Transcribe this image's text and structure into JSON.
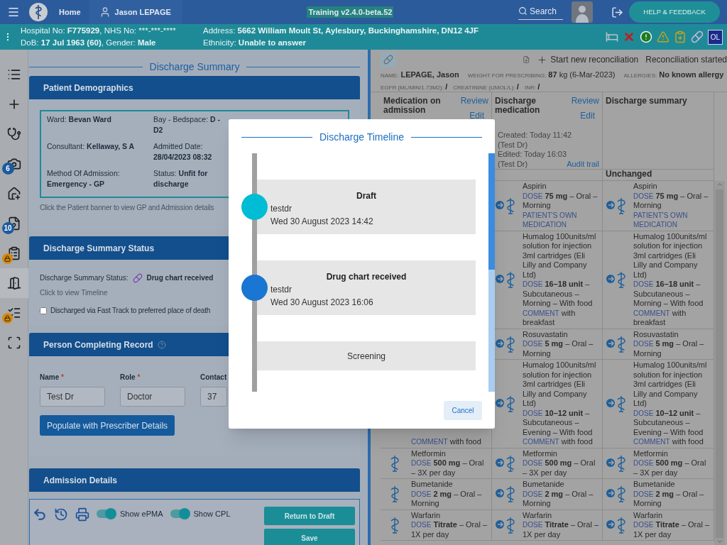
{
  "top_bar": {
    "home": "Home",
    "patient": "Jason LEPAGE",
    "version": "Training v2.4.0-beta.52",
    "search": "Search",
    "help": "HELP & FEEDBACK"
  },
  "banner": {
    "columns": [
      [
        [
          "Hospital No: ",
          "F775929",
          ", NHS No: ***-***-****"
        ],
        [
          "DoB: ",
          "17 Jul 1963 (60)",
          ", Gender: ",
          "Male"
        ]
      ],
      [
        [
          "Address: ",
          "5662 William Moult St, Aylesbury, Buckinghamshire, DN12 4JF"
        ],
        [
          "Ethnicity: ",
          "Unable to answer"
        ]
      ]
    ],
    "badge": "OL"
  },
  "rail": [
    {
      "kind": "list",
      "selected": false
    },
    {
      "kind": "add",
      "selected": false
    },
    {
      "kind": "stethoscope",
      "selected": false
    },
    {
      "kind": "camera",
      "selected": false,
      "badge": "6"
    },
    {
      "kind": "home",
      "selected": false
    },
    {
      "kind": "document",
      "selected": false,
      "badge": "10"
    },
    {
      "kind": "clipboard",
      "selected": false,
      "locked": true
    },
    {
      "kind": "discharge",
      "selected": true
    },
    {
      "kind": "checklist",
      "selected": false,
      "locked": true
    },
    {
      "kind": "xray",
      "selected": false
    }
  ],
  "form": {
    "title": "Discharge Summary",
    "demographics": {
      "header": "Patient Demographics",
      "fields": [
        {
          "label": "Ward:",
          "value": "Bevan Ward"
        },
        {
          "label": "Bay - Bedspace:",
          "value": "D - D2"
        },
        {
          "label": "Consultant:",
          "value": "Kellaway, S A"
        },
        {
          "label": "Admitted Date:",
          "value": "28/04/2023 08:32"
        },
        {
          "label": "Method Of Admission:",
          "value": "Emergency - GP"
        },
        {
          "label": "Status:",
          "value": "Unfit for discharge"
        }
      ],
      "hint": "Click the Patient banner to view GP and Admission details"
    },
    "status": {
      "header": "Discharge Summary Status",
      "label": "Discharge Summary Status:",
      "value": "Drug chart received",
      "link": "Click to view Timeline",
      "checkbox": {
        "label": "Discharged via Fast Track to preferred place of death",
        "checked": false
      }
    },
    "person": {
      "header": "Person Completing Record",
      "fields": [
        {
          "label": "Name",
          "required": "*",
          "value": "Test Dr"
        },
        {
          "label": "Role",
          "required": "*",
          "value": "Doctor"
        },
        {
          "label": "Contact",
          "value": "37"
        }
      ],
      "button": "Populate with Prescriber Details"
    },
    "admission": {
      "header": "Admission Details"
    },
    "toolbar": {
      "toggles": [
        {
          "label": "Show ePMA",
          "on": true
        },
        {
          "label": "Show CPL",
          "on": true
        }
      ],
      "buttons": [
        "Return to Draft",
        "Save"
      ]
    }
  },
  "meds": {
    "toolbar": {
      "start": "Start new reconciliation",
      "started": "Reconciliation started"
    },
    "patient": [
      {
        "label": "NAME:",
        "value": "LEPAGE, Jason"
      },
      {
        "label": "WEIGHT FOR PRESCRIBING:",
        "value": "87",
        "extra": "kg (6-Mar-2023)"
      },
      {
        "label": "ALLERGIES:",
        "value": "No known allergy"
      }
    ],
    "labs": [
      {
        "label": "EGFR (ML/MIN/1.73M2):",
        "value": "/"
      },
      {
        "label": "CREATININE (UMOL/L):",
        "value": "/"
      },
      {
        "label": "INR:",
        "value": "/"
      }
    ],
    "columns": [
      {
        "title": "Medication on admission",
        "links": [
          "Review",
          "Edit"
        ]
      },
      {
        "title": "Discharge medication",
        "links": [
          "Review",
          "Edit"
        ],
        "info": [
          "Created: Today 11:42",
          "(Test Dr)",
          "Edited: Today 16:03",
          "(Test Dr)"
        ],
        "audit": "Audit trail"
      },
      {
        "title": "Discharge summary"
      }
    ],
    "group": "Unchanged",
    "rows": [
      {
        "discharge": {
          "kind": "transfer",
          "name": "Aspirin",
          "dose_label": "DOSE",
          "dose": "75 mg",
          "rest": "– Oral – Morning",
          "note_label": "PATIENT'S OWN MEDICATION"
        },
        "summary": {
          "kind": "transfer",
          "name": "Aspirin",
          "dose_label": "DOSE",
          "dose": "75 mg",
          "rest": "– Oral – Morning",
          "note_label": "PATIENT'S OWN MEDICATION"
        }
      },
      {
        "discharge": {
          "kind": "transfer",
          "name": "Humalog 100units/ml solution for injection 3ml cartridges (Eli Lilly and Company Ltd)",
          "dose_label": "DOSE",
          "dose": "16–18 unit",
          "rest": "– Subcutaneous – Morning – With food",
          "note_label": "COMMENT",
          "note": "with breakfast"
        },
        "summary": {
          "kind": "transfer",
          "name": "Humalog 100units/ml solution for injection 3ml cartridges (Eli Lilly and Company Ltd)",
          "dose_label": "DOSE",
          "dose": "16–18 unit",
          "rest": "– Subcutaneous – Morning – With food",
          "note_label": "COMMENT",
          "note": "with breakfast"
        }
      },
      {
        "discharge": {
          "kind": "transfer",
          "name": "Rosuvastatin",
          "dose_label": "DOSE",
          "dose": "5 mg",
          "rest": "– Oral – Morning"
        },
        "summary": {
          "kind": "transfer",
          "name": "Rosuvastatin",
          "dose_label": "DOSE",
          "dose": "5 mg",
          "rest": "– Oral – Morning"
        }
      },
      {
        "admission": {
          "note_label": "COMMENT",
          "note": "with food"
        },
        "discharge": {
          "kind": "transfer",
          "name": "Humalog 100units/ml solution for injection 3ml cartridges (Eli Lilly and Company Ltd)",
          "dose_label": "DOSE",
          "dose": "10–12 unit",
          "rest": "– Subcutaneous – Evening – With food",
          "note_label": "COMMENT",
          "note": "with food"
        },
        "summary": {
          "kind": "transfer",
          "name": "Humalog 100units/ml solution for injection 3ml cartridges (Eli Lilly and Company Ltd)",
          "dose_label": "DOSE",
          "dose": "10–12 unit",
          "rest": "– Subcutaneous – Evening – With food",
          "note_label": "COMMENT",
          "note": "with food"
        }
      },
      {
        "admission": {
          "kind": "plain",
          "name": "Metformin",
          "dose_label": "DOSE",
          "dose": "500 mg",
          "rest": "– Oral – 3X per day"
        },
        "discharge": {
          "kind": "transfer",
          "name": "Metformin",
          "dose_label": "DOSE",
          "dose": "500 mg",
          "rest": "– Oral – 3X per day"
        },
        "summary": {
          "kind": "transfer",
          "name": "Metformin",
          "dose_label": "DOSE",
          "dose": "500 mg",
          "rest": "– Oral – 3X per day"
        }
      },
      {
        "admission": {
          "kind": "plain",
          "name": "Bumetanide",
          "dose_label": "DOSE",
          "dose": "2 mg",
          "rest": "– Oral – Morning"
        },
        "discharge": {
          "kind": "transfer",
          "name": "Bumetanide",
          "dose_label": "DOSE",
          "dose": "2 mg",
          "rest": "– Oral – Morning"
        },
        "summary": {
          "kind": "transfer",
          "name": "Bumetanide",
          "dose_label": "DOSE",
          "dose": "2 mg",
          "rest": "– Oral – Morning"
        }
      },
      {
        "admission": {
          "kind": "plain",
          "name": "Warfarin",
          "dose_label": "DOSE",
          "dose": "Titrate",
          "rest": "– Oral – 1X per day"
        },
        "discharge": {
          "kind": "transfer",
          "name": "Warfarin",
          "dose_label": "DOSE",
          "dose": "Titrate",
          "rest": "– Oral – 1X per day"
        },
        "summary": {
          "kind": "transfer",
          "name": "Warfarin",
          "dose_label": "DOSE",
          "dose": "Titrate",
          "rest": "– Oral – 1X per day"
        }
      }
    ]
  },
  "dialog": {
    "title": "Discharge Timeline",
    "events": [
      {
        "kind": "done",
        "title": "Draft",
        "user": "testdr",
        "time": "Wed 30 August 2023 14:42",
        "color": "#00bcd4"
      },
      {
        "kind": "done",
        "title": "Drug chart received",
        "user": "testdr",
        "time": "Wed 30 August 2023 16:06",
        "color": "#1976d2"
      },
      {
        "kind": "pending",
        "title": "Screening"
      }
    ],
    "button": "Cancel"
  }
}
